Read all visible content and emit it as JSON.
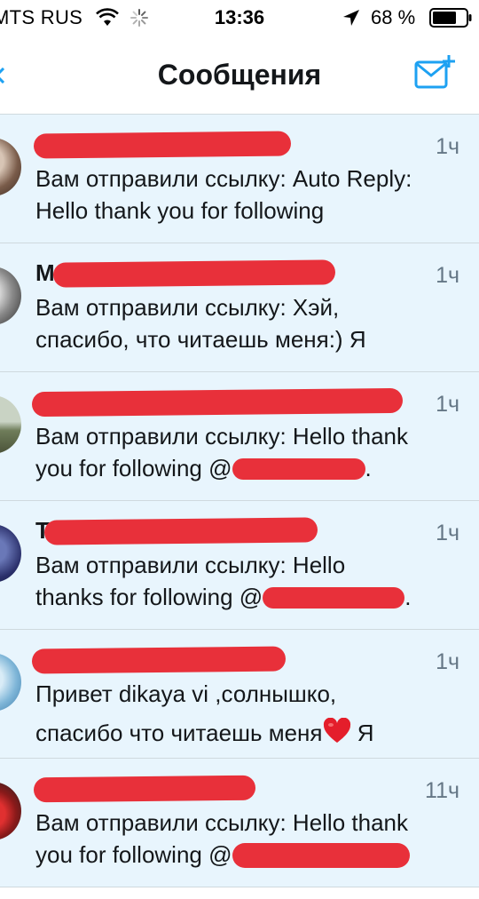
{
  "status_bar": {
    "carrier": "MTS RUS",
    "time": "13:36",
    "battery_percent": "68 %",
    "icons": [
      "wifi-icon",
      "loading-spinner-icon",
      "location-arrow-icon",
      "battery-icon"
    ]
  },
  "nav": {
    "title": "Сообщения",
    "compose_icon": "compose-message-icon",
    "back_icon": "back-chevron-icon"
  },
  "colors": {
    "accent": "#1da1f2",
    "unread_background": "#e8f5fd",
    "redaction": "#e8303a",
    "time_text": "#657786"
  },
  "messages": [
    {
      "time": "1ч",
      "preview_line1": "Вам отправили ссылку: Auto Reply:",
      "preview_line2": "Hello thank you for following"
    },
    {
      "name_visible": "М",
      "time": "1ч",
      "preview_line1": "Вам отправили ссылку: Хэй,",
      "preview_line2": "спасибо, что читаешь меня:) Я"
    },
    {
      "time": "1ч",
      "preview_line1": "Вам отправили ссылку: Hello thank",
      "preview_line2_prefix": "you for following @",
      "preview_line2_suffix": "."
    },
    {
      "name_visible": "Т",
      "time": "1ч",
      "preview_line1": "Вам отправили ссылку: Hello",
      "preview_line2_prefix": "thanks for following @",
      "preview_line2_suffix": "."
    },
    {
      "time": "1ч",
      "preview_line1": "Привет dikaya vi ,солнышко,",
      "preview_line2_prefix": "спасибо что читаешь меня",
      "preview_line2_suffix": " Я"
    },
    {
      "time": "11ч",
      "preview_line1": "Вам отправили ссылку: Hello thank",
      "preview_line2_prefix": "you for following @",
      "preview_line2_suffix": ""
    }
  ]
}
